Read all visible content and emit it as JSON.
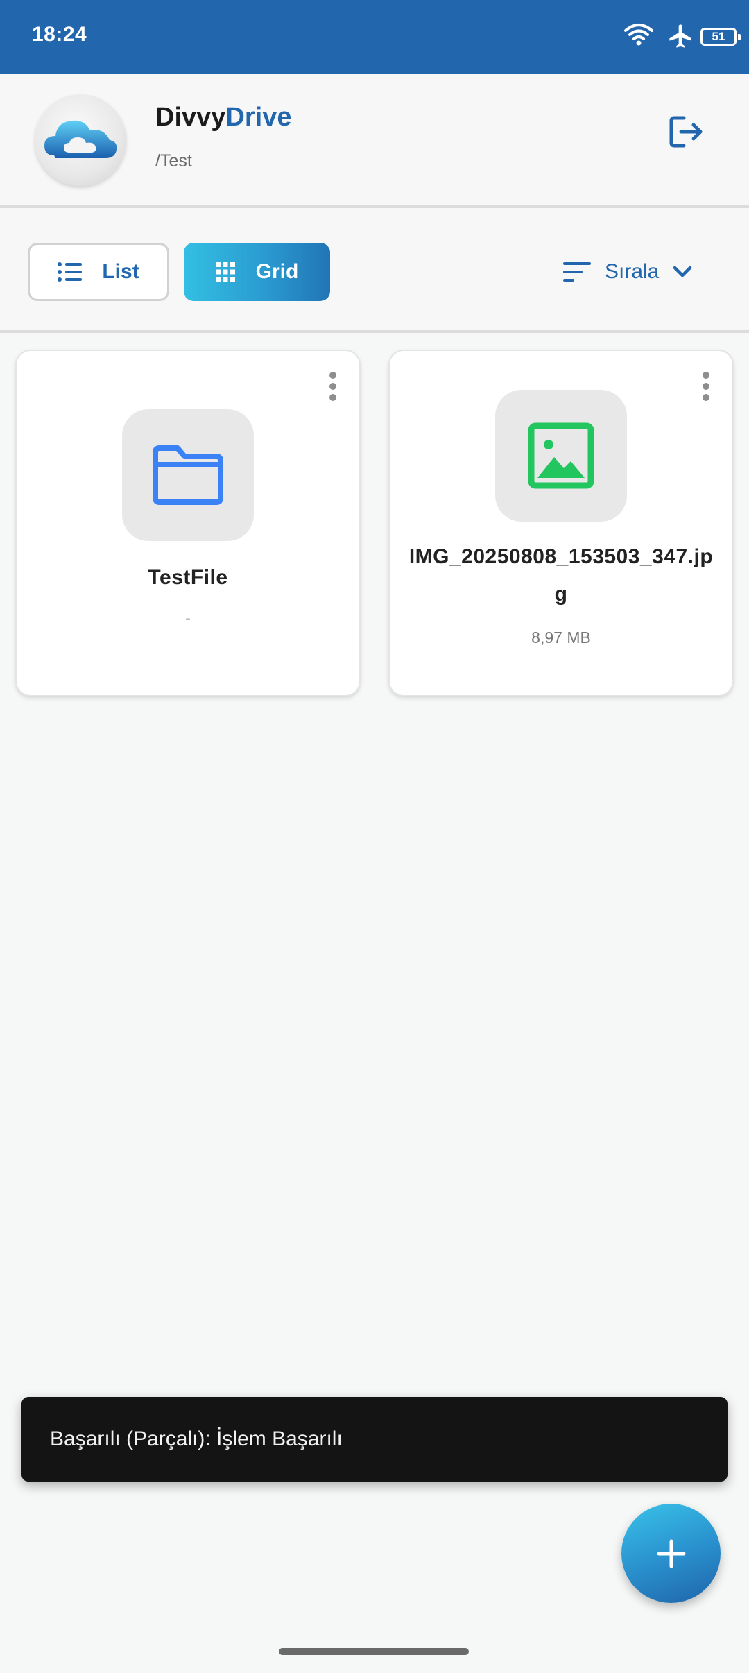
{
  "status_bar": {
    "time": "18:24",
    "battery": "51",
    "icons": [
      "wifi-icon",
      "airplane-icon",
      "battery-icon"
    ]
  },
  "header": {
    "brand_part1": "Divvy",
    "brand_part2": "Drive",
    "path": "/Test",
    "logo": "cloud-logo",
    "logout_icon": "logout-icon"
  },
  "toolbar": {
    "list_label": "List",
    "grid_label": "Grid",
    "sort_label": "Sırala",
    "active_view": "Grid"
  },
  "items": [
    {
      "name": "TestFile",
      "meta": "-",
      "type": "folder",
      "icon": "folder-icon"
    },
    {
      "name": "IMG_20250808_153503_347.jpg",
      "meta": "8,97 MB",
      "type": "image",
      "icon": "image-icon"
    }
  ],
  "snackbar": {
    "message": "Başarılı (Parçalı): İşlem Başarılı"
  },
  "fab": {
    "icon": "plus-icon"
  },
  "colors": {
    "primary": "#2266ae",
    "accent": "#33bfe3",
    "folder": "#3b82f6",
    "image": "#22c55e"
  }
}
